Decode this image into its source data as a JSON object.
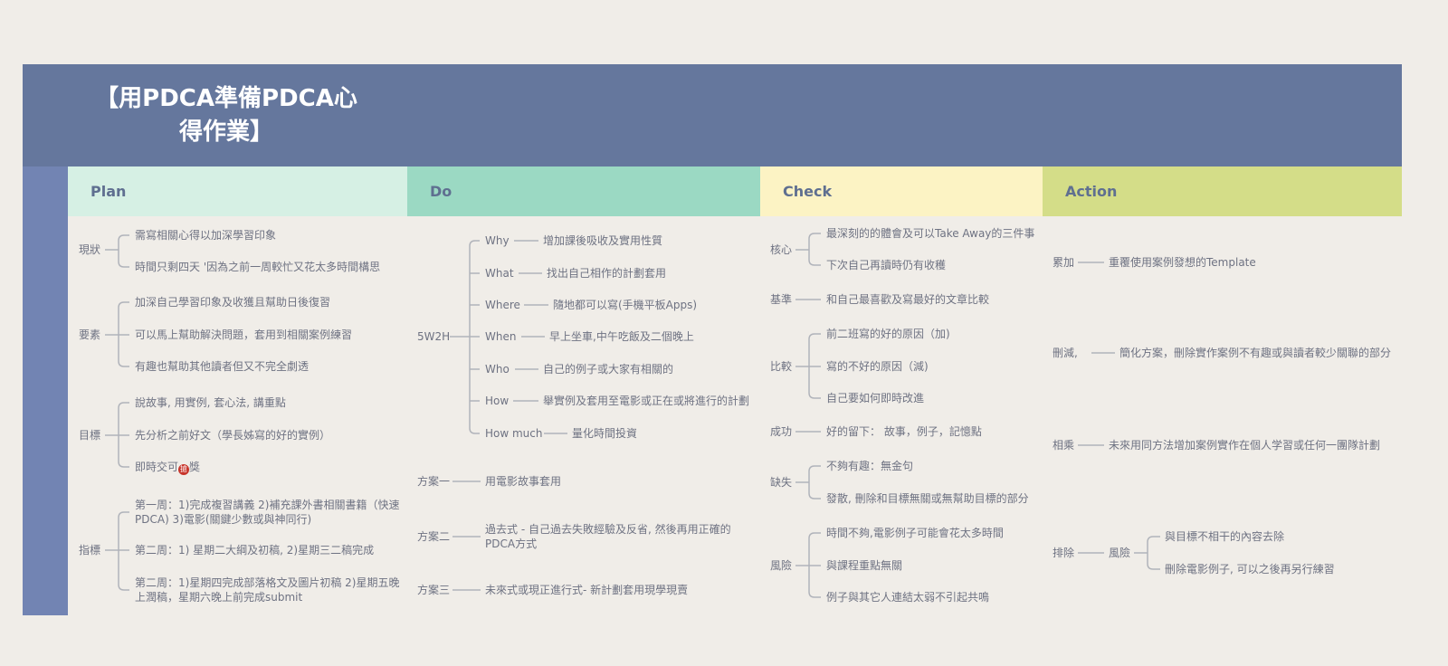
{
  "title": {
    "line1": "【用PDCA準備PDCA心",
    "line2": "得作業】"
  },
  "columns": [
    {
      "label": "Plan",
      "color": "#d6f0e4"
    },
    {
      "label": "Do",
      "color": "#9bd9c3"
    },
    {
      "label": "Check",
      "color": "#fcf3c4"
    },
    {
      "label": "Action",
      "color": "#d4dd88"
    }
  ],
  "plan": {
    "groups": [
      {
        "label": "現狀",
        "items": [
          "需寫相關心得以加深學習印象",
          "時間只剩四天 '因為之前一周較忙又花太多時間構思"
        ]
      },
      {
        "label": "要素",
        "items": [
          "加深自己學習印象及收獲且幫助日後復習",
          "可以馬上幫助解決問題，套用到相關案例練習",
          "有趣也幫助其他讀者但又不完全劇透"
        ]
      },
      {
        "label": "目標",
        "items": [
          "說故事, 用實例, 套心法, 講重點",
          "先分析之前好文（學長姊寫的好的實例）",
          "即時交可",
          "獎"
        ]
      },
      {
        "label": "指標",
        "items": [
          "第一周：1)完成複習講義 2)補充課外書相關書籍（快速PDCA) 3)電影(關鍵少數或與神同行)",
          "第二周：1) 星期二大綱及初稿, 2)星期三二稿完成",
          "第二周：1)星期四完成部落格文及圖片初稿 2)星期五晚上潤稿，星期六晚上前完成submit"
        ]
      }
    ],
    "stamp_glyph": "搶"
  },
  "do": {
    "w2h_label": "5W2H",
    "w2h": [
      {
        "key": "Why",
        "value": "增加課後吸收及實用性質"
      },
      {
        "key": "What",
        "value": "找出自己相作的計劃套用"
      },
      {
        "key": "Where",
        "value": "隨地都可以寫(手機平板Apps)"
      },
      {
        "key": "When",
        "value": "早上坐車,中午吃飯及二個晚上"
      },
      {
        "key": "Who",
        "value": "自己的例子或大家有相關的"
      },
      {
        "key": "How",
        "value": "舉實例及套用至電影或正在或將進行的計劃"
      },
      {
        "key": "How much",
        "value": "量化時間投資"
      }
    ],
    "plans": [
      {
        "key": "方案一",
        "value": "用電影故事套用"
      },
      {
        "key": "方案二",
        "value": "過去式 - 自己過去失敗經驗及反省, 然後再用正確的PDCA方式"
      },
      {
        "key": "方案三",
        "value": "未來式或現正進行式- 新計劃套用現學現賣"
      }
    ]
  },
  "check": {
    "groups": [
      {
        "label": "核心",
        "items": [
          "最深刻的的體會及可以Take Away的三件事",
          "下次自己再讀時仍有收穫"
        ]
      },
      {
        "label": "基準",
        "items": [
          "和自己最喜歡及寫最好的文章比較"
        ]
      },
      {
        "label": "比較",
        "items": [
          "前二班寫的好的原因（加)",
          "寫的不好的原因（減)",
          "自己要如何即時改進"
        ]
      },
      {
        "label": "成功",
        "items": [
          "好的留下： 故事，例子，記憶點"
        ]
      },
      {
        "label": "缺失",
        "items": [
          "不夠有趣：無金句",
          "發散, 刪除和目標無關或無幫助目標的部分"
        ]
      },
      {
        "label": "風險",
        "items": [
          "時間不夠,電影例子可能會花太多時間",
          "與課程重點無關",
          "例子與其它人連結太弱不引起共鳴"
        ]
      }
    ]
  },
  "action": {
    "items": [
      {
        "key": "累加",
        "value": "重覆使用案例發想的Template"
      },
      {
        "key": "刪減,",
        "value": "簡化方案，刪除實作案例不有趣或與讀者較少關聯的部分"
      },
      {
        "key": "相乘",
        "value": "未來用同方法增加案例實作在個人学習或任何一團隊計劃"
      }
    ],
    "elim": {
      "key": "排除",
      "sub": "風險",
      "items": [
        "與目標不相干的內容去除",
        "刪除電影例子, 可以之後再另行練習"
      ]
    }
  },
  "colors": {
    "header": "#65779d",
    "leftbar": "#7284b3",
    "line": "#b0b3ba",
    "stamp": "#c8342a"
  }
}
